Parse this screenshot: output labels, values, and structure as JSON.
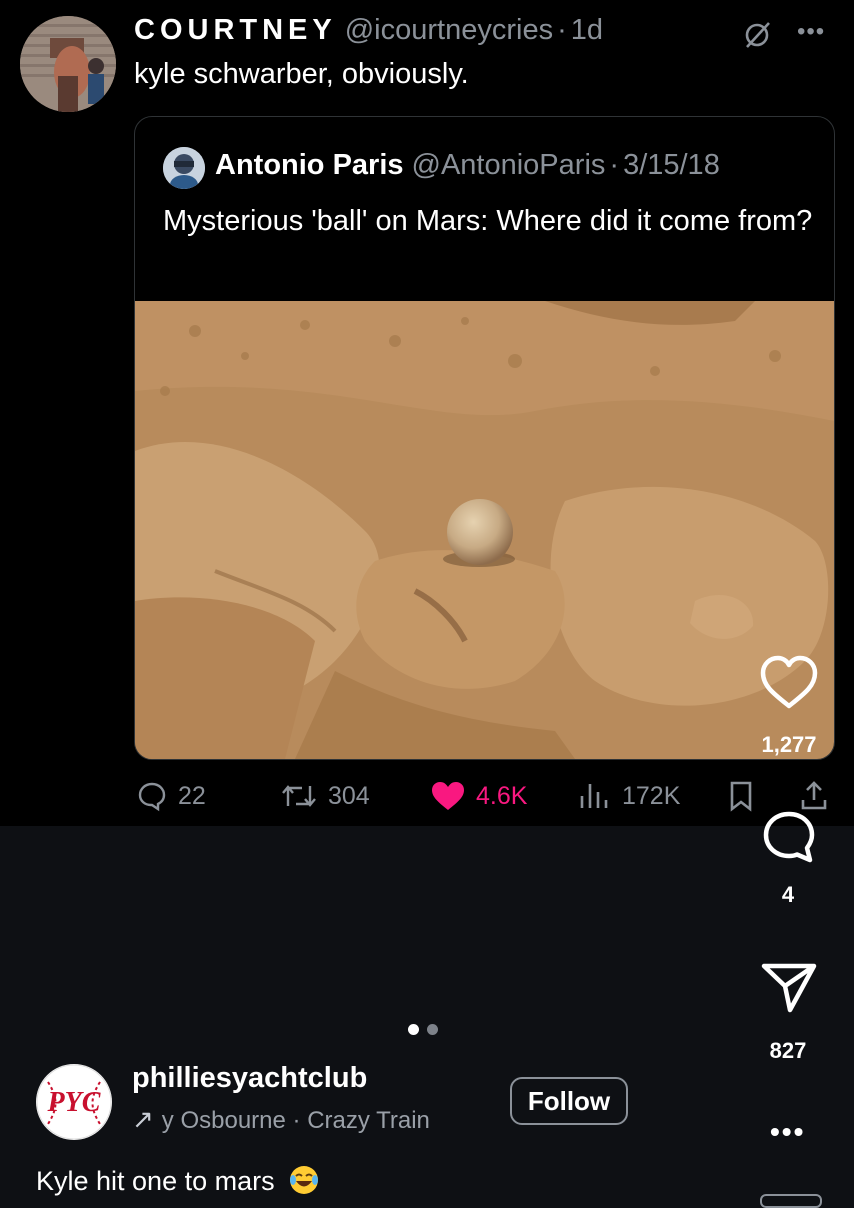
{
  "tweet": {
    "display_name": "COURTNEY",
    "handle": "@icourtneycries",
    "time": "1d",
    "text": "kyle schwarber, obviously."
  },
  "quoted": {
    "display_name": "Antonio Paris",
    "handle": "@AntonioParis",
    "date": "3/15/18",
    "text": "Mysterious 'ball' on Mars: Where did it come from?"
  },
  "actions": {
    "replies": "22",
    "retweets": "304",
    "likes": "4.6K",
    "views": "172K",
    "like_color": "#f91880"
  },
  "reel": {
    "likes_count": "1,277",
    "comments_count": "4",
    "shares_count": "827"
  },
  "post": {
    "account": "philliesyachtclub",
    "audio_prefix": "y Osbourne",
    "audio_track": "Crazy Train",
    "follow_label": "Follow",
    "caption": "Kyle hit one to mars",
    "logo_text": "PYC"
  }
}
